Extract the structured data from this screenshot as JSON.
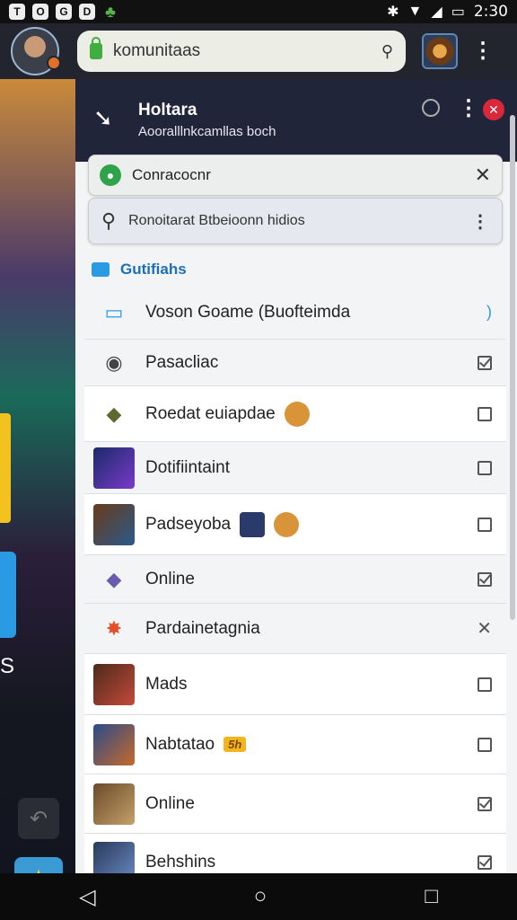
{
  "status_bar": {
    "icons": [
      "T",
      "O",
      "G",
      "D"
    ],
    "clover_icon": "clover-icon",
    "time": "2:30"
  },
  "app_bar": {
    "search_text": "komunitaas"
  },
  "panel": {
    "title": "Holtara",
    "subtitle": "Aooralllnkcamllas boch",
    "search_card": {
      "text": "Conracocnr"
    },
    "filter_card": {
      "text": "Ronoitarat Btbeioonn hidios"
    },
    "section_label": "Gutifiahs",
    "items": [
      {
        "label": "Voson Goame (Buofteimda",
        "state": "none"
      },
      {
        "label": "Pasacliac",
        "state": "checked"
      },
      {
        "label": "Roedat euiapdae",
        "state": "unchecked"
      },
      {
        "label": "Dotifiintaint",
        "state": "unchecked"
      },
      {
        "label": "Padseyoba",
        "state": "unchecked"
      },
      {
        "label": "Online",
        "state": "checked"
      },
      {
        "label": "Pardainetagnia",
        "state": "cross"
      },
      {
        "label": "Mads",
        "state": "unchecked"
      },
      {
        "label": "Nabtatao",
        "state": "unchecked",
        "badge": "5h"
      },
      {
        "label": "Online",
        "state": "checked"
      },
      {
        "label": "Behshins",
        "state": "checked"
      }
    ]
  },
  "left_art": {
    "letter": "S"
  },
  "colors": {
    "accent": "#1c6fb5",
    "panel_header": "#20253a",
    "close_red": "#d8283a"
  }
}
